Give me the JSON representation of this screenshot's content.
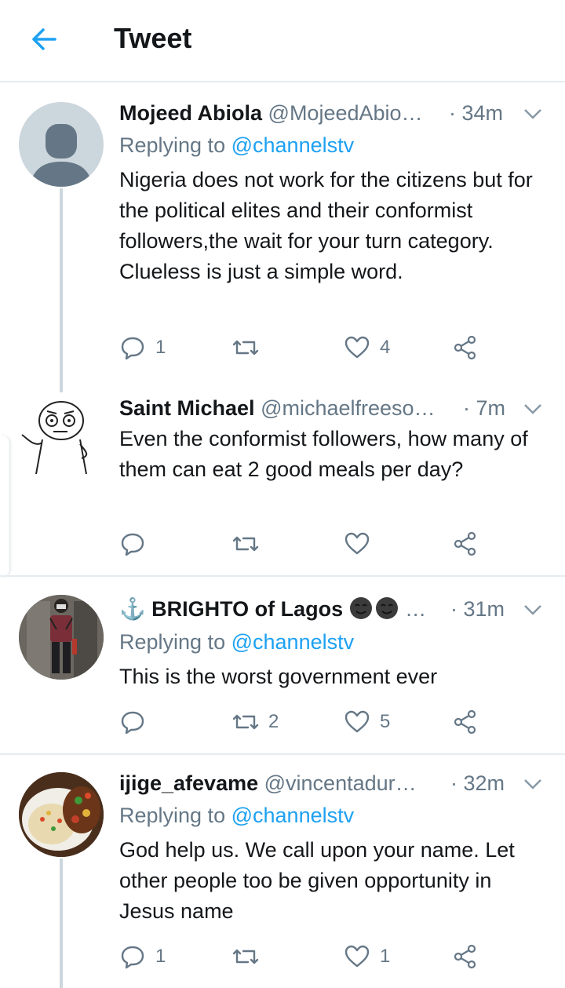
{
  "header": {
    "title": "Tweet"
  },
  "replying_prefix": "Replying to",
  "tweets": [
    {
      "name": "Mojeed Abiola",
      "handle": "@MojeedAbio…",
      "time": "· 34m",
      "replying_to": "@channelstv",
      "text": "Nigeria does not work for the citizens but for the political elites and their conformist followers,the wait for your turn category. Clueless is just a simple word.",
      "replies": "1",
      "retweets": "",
      "likes": "4"
    },
    {
      "name": "Saint Michael",
      "handle": "@michaelfreeso…",
      "time": "· 7m",
      "replying_to": "",
      "text": "Even the conformist followers, how many of them can eat 2 good meals per day?",
      "replies": "",
      "retweets": "",
      "likes": ""
    },
    {
      "name": "⚓ BRIGHTO of Lagos",
      "handle": "…",
      "time": "· 31m",
      "replying_to": "@channelstv",
      "text": "This is the worst government ever",
      "replies": "",
      "retweets": "2",
      "likes": "5"
    },
    {
      "name": "ijige_afevame",
      "handle": "@vincentadur…",
      "time": "· 32m",
      "replying_to": "@channelstv",
      "text": "God help us. We call upon your name. Let other people too be given opportunity in Jesus name",
      "replies": "1",
      "retweets": "",
      "likes": "1"
    }
  ],
  "colors": {
    "accent": "#1da1f2",
    "secondary_text": "#657786",
    "divider": "#e6ecf0"
  }
}
